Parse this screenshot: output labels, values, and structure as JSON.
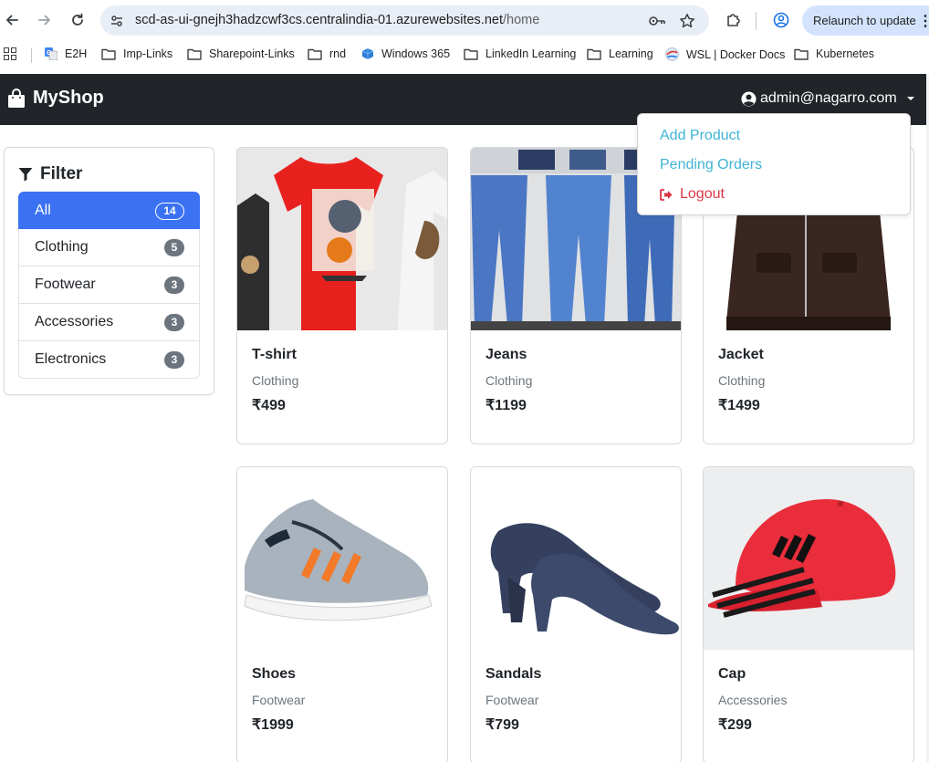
{
  "browser": {
    "url_host": "scd-as-ui-gnejh3hadzcwf3cs.centralindia-01.azurewebsites.net",
    "url_path": "/home",
    "relaunch_label": "Relaunch to update",
    "bookmarks": [
      "E2H",
      "Imp-Links",
      "Sharepoint-Links",
      "rnd",
      "Windows 365",
      "LinkedIn Learning",
      "Learning",
      "WSL | Docker Docs",
      "Kubernetes"
    ]
  },
  "navbar": {
    "brand": "MyShop",
    "user_email": "admin@nagarro.com"
  },
  "dropdown": {
    "items": [
      "Add Product",
      "Pending Orders",
      "Logout"
    ]
  },
  "filter": {
    "title": "Filter",
    "items": [
      {
        "label": "All",
        "count": "14",
        "active": true
      },
      {
        "label": "Clothing",
        "count": "5"
      },
      {
        "label": "Footwear",
        "count": "3"
      },
      {
        "label": "Accessories",
        "count": "3"
      },
      {
        "label": "Electronics",
        "count": "3"
      }
    ]
  },
  "products": [
    {
      "name": "T-shirt",
      "category": "Clothing",
      "price": "₹499"
    },
    {
      "name": "Jeans",
      "category": "Clothing",
      "price": "₹1199"
    },
    {
      "name": "Jacket",
      "category": "Clothing",
      "price": "₹1499"
    },
    {
      "name": "Shoes",
      "category": "Footwear",
      "price": "₹1999"
    },
    {
      "name": "Sandals",
      "category": "Footwear",
      "price": "₹799"
    },
    {
      "name": "Cap",
      "category": "Accessories",
      "price": "₹299"
    }
  ],
  "colors": {
    "navbar_bg": "#212529",
    "active_filter": "#3b71f3",
    "dropdown_link": "#3fb4d6",
    "logout": "#dc3545",
    "badge": "#6c757d"
  }
}
